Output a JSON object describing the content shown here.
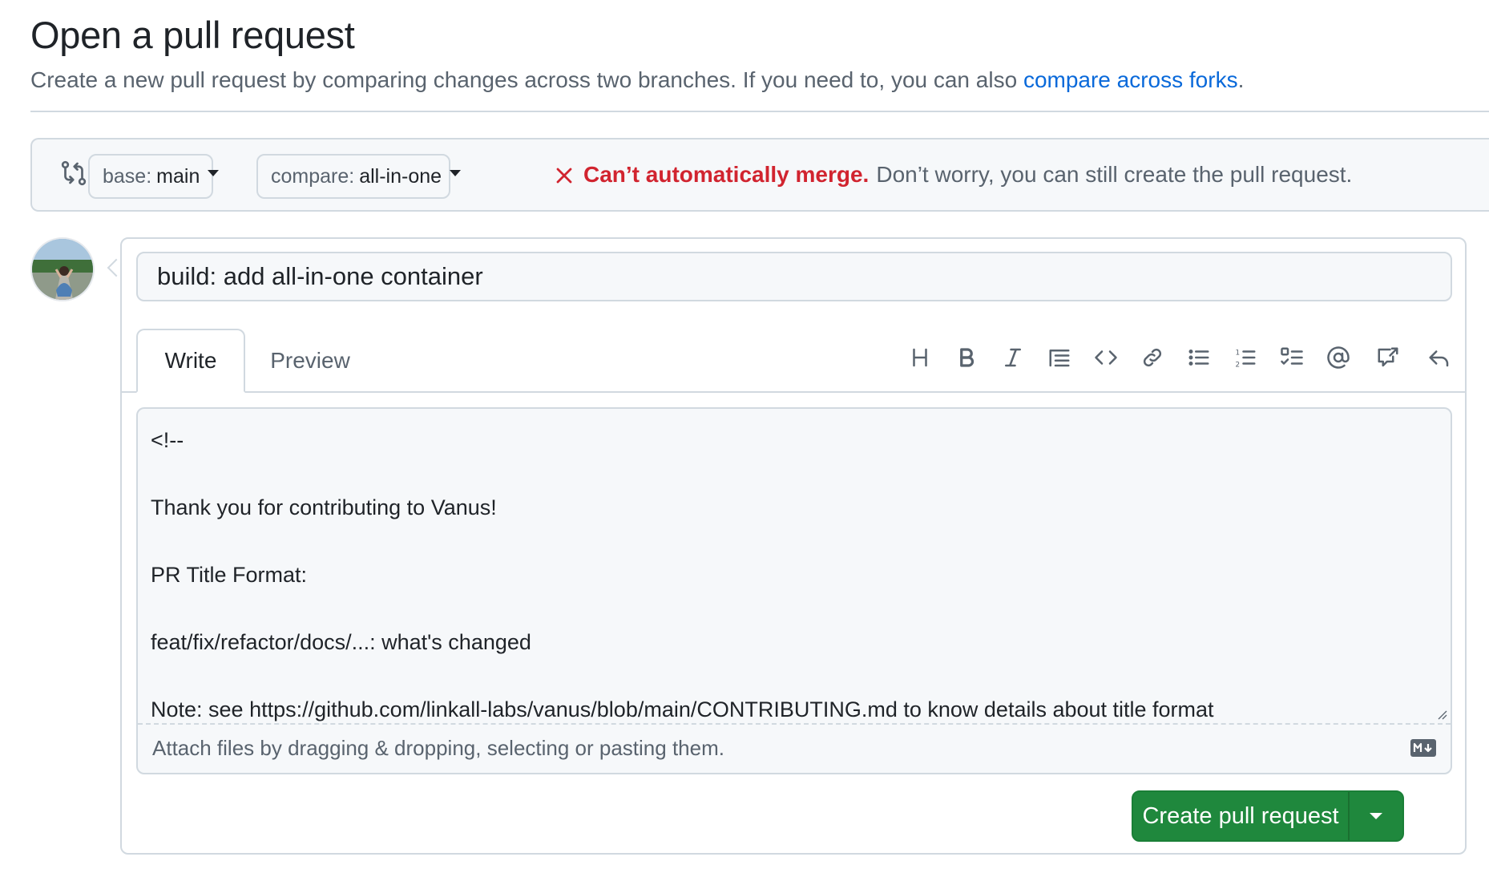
{
  "header": {
    "title": "Open a pull request",
    "subtitle": "Create a new pull request by comparing changes across two branches. If you need to, you can also ",
    "subtitle_link": "compare across forks",
    "subtitle_end": "."
  },
  "range": {
    "base_label": "base:",
    "base_value": "main",
    "compare_label": "compare:",
    "compare_value": "all-in-one",
    "merge_status": "Can’t automatically merge.",
    "merge_info": "Don’t worry, you can still create the pull request."
  },
  "form": {
    "title_value": "build: add all-in-one container",
    "tabs": {
      "write": "Write",
      "preview": "Preview"
    },
    "toolbar_icons": [
      "heading-icon",
      "bold-icon",
      "italic-icon",
      "quote-icon",
      "code-icon",
      "link-icon",
      "unordered-list-icon",
      "ordered-list-icon",
      "task-list-icon",
      "mention-icon",
      "cross-reference-icon",
      "reply-icon"
    ],
    "body_lines": [
      "<!--",
      "",
      "Thank you for contributing to Vanus!",
      "",
      "PR Title Format:",
      "",
      "feat/fix/refactor/docs/...: what's changed",
      "",
      "Note: see https://github.com/linkall-labs/vanus/blob/main/CONTRIBUTING.md to know details about title format"
    ],
    "attach_text": "Attach files by dragging & dropping, selecting or pasting them.",
    "submit_label": "Create pull request"
  },
  "colors": {
    "accent_link": "#0969da",
    "error": "#d1242f",
    "primary_button": "#1f883d",
    "muted_text": "#59636e",
    "border": "#d1d9e0"
  }
}
